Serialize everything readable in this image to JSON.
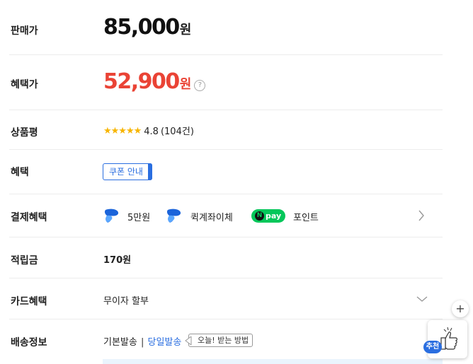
{
  "rows": {
    "price": {
      "label": "판매가",
      "amount": "85,000",
      "unit": "원"
    },
    "benefit_price": {
      "label": "혜택가",
      "amount": "52,900",
      "unit": "원",
      "help": "?"
    },
    "review": {
      "label": "상품평",
      "stars": "★★★★★",
      "rating": "4.8",
      "count": "(104건)"
    },
    "benefit": {
      "label": "혜택",
      "coupon_button": "쿠폰 안내"
    },
    "payment": {
      "label": "결제혜택",
      "items": [
        {
          "icon": "toss-icon",
          "text": "5만원"
        },
        {
          "icon": "toss-icon",
          "text": "퀵계좌이체"
        },
        {
          "icon": "npay-icon",
          "badge": "pay",
          "text": "포인트"
        }
      ]
    },
    "points": {
      "label": "적립금",
      "value": "170원"
    },
    "card": {
      "label": "카드혜택",
      "value": "무이자 할부"
    },
    "shipping": {
      "label": "배송정보",
      "standard": "기본발송",
      "separator": "|",
      "same_day": "당일발송",
      "today_tag": "오늘! 받는 방법"
    }
  },
  "floating": {
    "plus": "+",
    "recommend_badge": "추천"
  },
  "colors": {
    "accent": "#2a6ee0",
    "sale": "#ea4335",
    "star": "#f7b500",
    "npay": "#03c75a"
  },
  "rating_value": 4.8
}
